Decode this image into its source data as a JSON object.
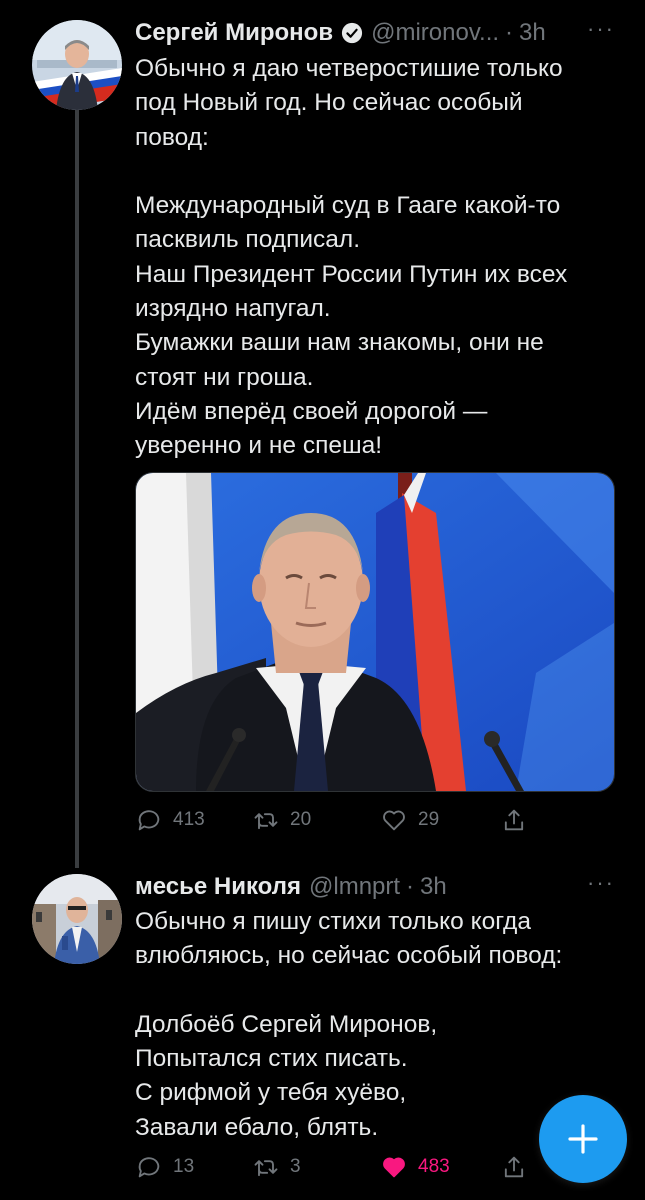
{
  "tweets": [
    {
      "author_name": "Сергей Миронов",
      "handle": "@mironov...",
      "separator": "·",
      "time": "3h",
      "verified": true,
      "more": "···",
      "text_lines": [
        "Обычно я даю четверостишие только",
        "под Новый год. Но сейчас особый",
        "повод:",
        "",
        "Международный суд в Гааге какой-то",
        "пасквиль подписал.",
        "Наш Президент России Путин их всех",
        "изрядно напугал.",
        "Бумажки ваши нам знакомы, они не",
        "стоят ни гроша.",
        "Идём вперёд своей дорогой —",
        "уверенно и не спеша!"
      ],
      "actions": {
        "replies": "413",
        "retweets": "20",
        "likes": "29"
      },
      "liked": false
    },
    {
      "author_name": "месье Николя",
      "handle": "@lmnprt",
      "separator": "·",
      "time": "3h",
      "verified": false,
      "more": "···",
      "text_lines": [
        "Обычно я пишу стихи только когда",
        "влюбляюсь, но сейчас особый повод:",
        "",
        "Долбоёб Сергей Миронов,",
        "Попытался стих писать.",
        "С рифмой у тебя хуёво,",
        "Завали ебало, блять."
      ],
      "actions": {
        "replies": "13",
        "retweets": "3",
        "likes": "483"
      },
      "liked": true
    }
  ],
  "colors": {
    "background": "#000000",
    "text": "#e7e9ea",
    "secondary": "#71767b",
    "accent": "#1d9bf0",
    "like": "#f91880"
  },
  "fab": {
    "icon": "plus-icon"
  }
}
